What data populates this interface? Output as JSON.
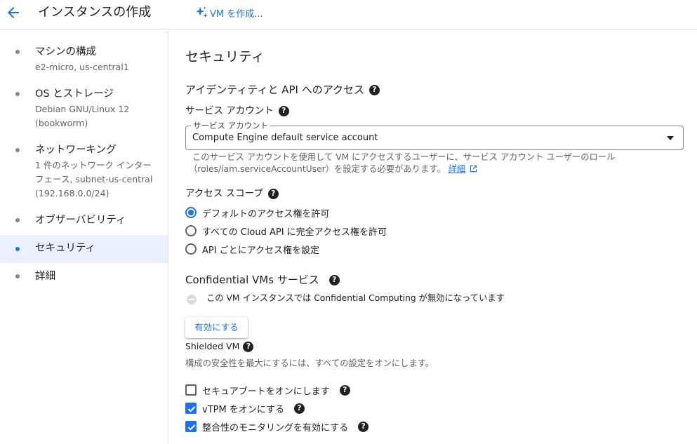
{
  "header": {
    "title": "インスタンスの作成",
    "create_vm_label": "VM を作成..."
  },
  "sidebar": {
    "items": [
      {
        "label": "マシンの構成",
        "sub": "e2-micro, us-central1"
      },
      {
        "label": "OS とストレージ",
        "sub": "Debian GNU/Linux 12 (bookworm)"
      },
      {
        "label": "ネットワーキング",
        "sub": "1 件のネットワーク インターフェース, subnet-us-central (192.168.0.0/24)"
      },
      {
        "label": "オブザーバビリティ",
        "sub": ""
      },
      {
        "label": "セキュリティ",
        "sub": "",
        "active": true
      },
      {
        "label": "詳細",
        "sub": ""
      }
    ]
  },
  "main": {
    "section_title": "セキュリティ",
    "identity_heading": "アイデンティティと API へのアクセス",
    "service_account_label": "サービス アカウント",
    "service_account_float_label": "サービス アカウント",
    "service_account_value": "Compute Engine default service account",
    "helper_line1": "このサービス アカウントを使用して VM にアクセスするユーザーに、サービス アカウント ユーザーのロール",
    "helper_line2": "（roles/iam.serviceAccountUser）を設定する必要があります。",
    "helper_link": "詳細",
    "access_scope_label": "アクセス スコープ",
    "access_scopes": [
      {
        "label": "デフォルトのアクセス権を許可",
        "selected": true
      },
      {
        "label": "すべての Cloud API に完全アクセス権を許可",
        "selected": false
      },
      {
        "label": "API ごとにアクセス権を設定",
        "selected": false
      }
    ],
    "confidential_heading": "Confidential VMs サービス",
    "confidential_status": "この VM インスタンスでは Confidential Computing が無効になっています",
    "enable_button": "有効にする",
    "shielded_heading": "Shielded VM",
    "shielded_desc": "構成の安全性を最大にするには、すべての設定をオンにします。",
    "shielded_options": [
      {
        "label": "セキュアブートをオンにします",
        "checked": false
      },
      {
        "label": "vTPM をオンにする",
        "checked": true
      },
      {
        "label": "整合性のモニタリングを有効にする",
        "checked": true
      }
    ]
  },
  "colors": {
    "accent": "#1a73e8",
    "active_nav_bg": "#e8f0fe",
    "text": "#202124",
    "secondary_text": "#5f6368"
  }
}
